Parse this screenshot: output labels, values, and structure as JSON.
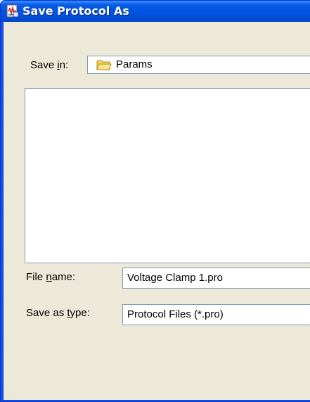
{
  "window": {
    "title": "Save Protocol As",
    "icon": "protocol-file-icon"
  },
  "save_in": {
    "label_prefix": "Save ",
    "label_accel": "i",
    "label_suffix": "n:",
    "folder_icon": "folder-icon",
    "value": "Params"
  },
  "file_name": {
    "label_prefix": "File ",
    "label_accel": "n",
    "label_suffix": "ame:",
    "value": "Voltage Clamp 1.pro"
  },
  "save_as_type": {
    "label_prefix": "Save as ",
    "label_accel": "t",
    "label_suffix": "ype:",
    "value": "Protocol Files (*.pro)"
  },
  "colors": {
    "titlebar": "#0054e3",
    "dialog_bg": "#ece9d8",
    "field_border": "#7f9db9"
  }
}
